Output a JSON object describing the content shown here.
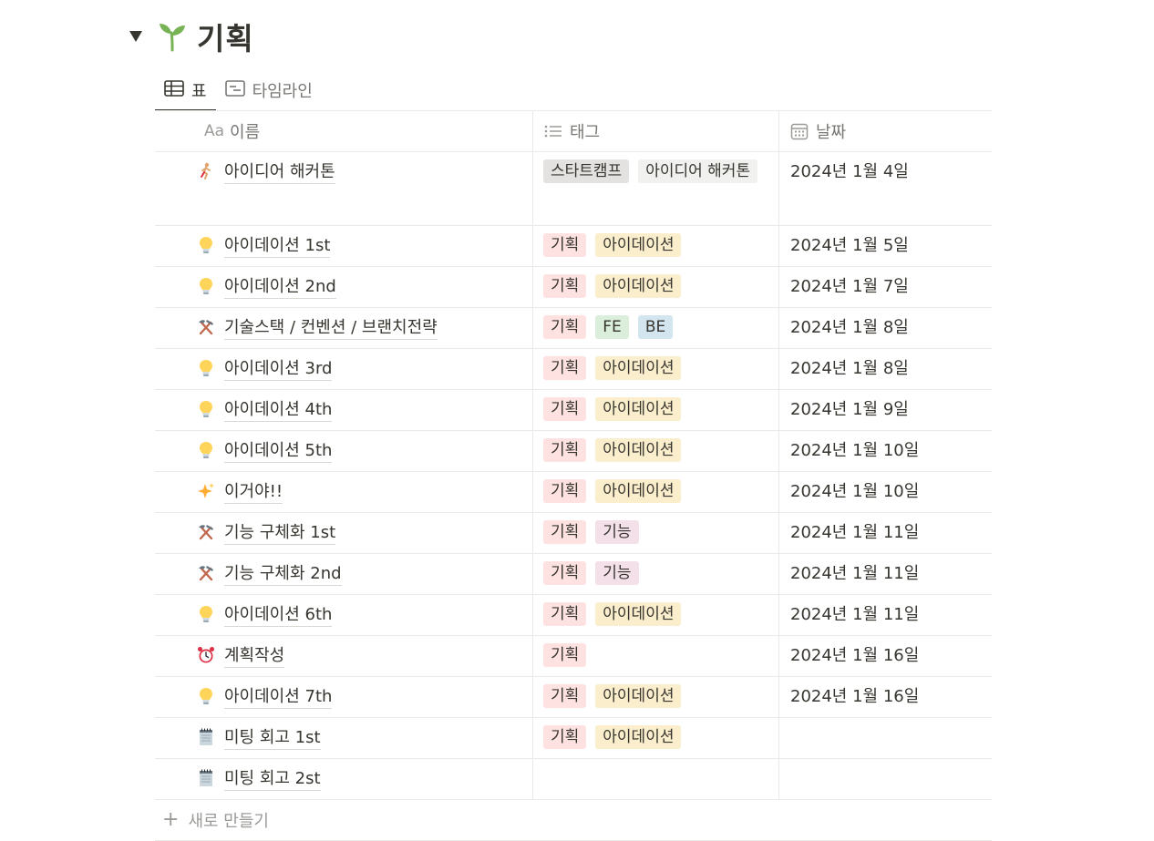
{
  "page": {
    "title": "기획"
  },
  "tabs": [
    {
      "label": "표",
      "active": true
    },
    {
      "label": "타임라인",
      "active": false
    }
  ],
  "columns": {
    "name": "이름",
    "name_prefix": "Aa",
    "tags": "태그",
    "date": "날짜"
  },
  "tag_colors": {
    "스타트캠프": "#e3e2e0",
    "아이디어 해커톤": "#f1f1ef",
    "기획": "#fde2e1",
    "아이데이션": "#fbeecc",
    "FE": "#dbeddb",
    "BE": "#d3e5ef",
    "기능": "#f4e0e9"
  },
  "rows": [
    {
      "icon": "runner-icon",
      "name": "아이디어 해커톤",
      "tags": [
        "스타트캠프",
        "아이디어 해커톤"
      ],
      "date": "2024년 1월 4일"
    },
    {
      "icon": "bulb-icon",
      "name": "아이데이션 1st",
      "tags": [
        "기획",
        "아이데이션"
      ],
      "date": "2024년 1월 5일"
    },
    {
      "icon": "bulb-icon",
      "name": "아이데이션 2nd",
      "tags": [
        "기획",
        "아이데이션"
      ],
      "date": "2024년 1월 7일"
    },
    {
      "icon": "hammer-pick-icon",
      "name": "기술스택 / 컨벤션 / 브랜치전략",
      "tags": [
        "기획",
        "FE",
        "BE"
      ],
      "date": "2024년 1월 8일"
    },
    {
      "icon": "bulb-icon",
      "name": "아이데이션 3rd",
      "tags": [
        "기획",
        "아이데이션"
      ],
      "date": "2024년 1월 8일"
    },
    {
      "icon": "bulb-icon",
      "name": "아이데이션 4th",
      "tags": [
        "기획",
        "아이데이션"
      ],
      "date": "2024년 1월 9일"
    },
    {
      "icon": "bulb-icon",
      "name": "아이데이션 5th",
      "tags": [
        "기획",
        "아이데이션"
      ],
      "date": "2024년 1월 10일"
    },
    {
      "icon": "sparkles-icon",
      "name": "이거야!!",
      "tags": [
        "기획",
        "아이데이션"
      ],
      "date": "2024년 1월 10일"
    },
    {
      "icon": "hammer-pick-icon",
      "name": "기능 구체화 1st",
      "tags": [
        "기획",
        "기능"
      ],
      "date": "2024년 1월 11일"
    },
    {
      "icon": "hammer-pick-icon",
      "name": "기능 구체화 2nd",
      "tags": [
        "기획",
        "기능"
      ],
      "date": "2024년 1월 11일"
    },
    {
      "icon": "bulb-icon",
      "name": "아이데이션 6th",
      "tags": [
        "기획",
        "아이데이션"
      ],
      "date": "2024년 1월 11일"
    },
    {
      "icon": "alarm-clock-icon",
      "name": "계획작성",
      "tags": [
        "기획"
      ],
      "date": "2024년 1월 16일"
    },
    {
      "icon": "bulb-icon",
      "name": "아이데이션 7th",
      "tags": [
        "기획",
        "아이데이션"
      ],
      "date": "2024년 1월 16일"
    },
    {
      "icon": "notepad-icon",
      "name": "미팅 회고 1st",
      "tags": [
        "기획",
        "아이데이션"
      ],
      "date": ""
    },
    {
      "icon": "notepad-icon",
      "name": "미팅 회고 2st",
      "tags": [],
      "date": ""
    }
  ],
  "new_row": {
    "label": "새로 만들기"
  }
}
